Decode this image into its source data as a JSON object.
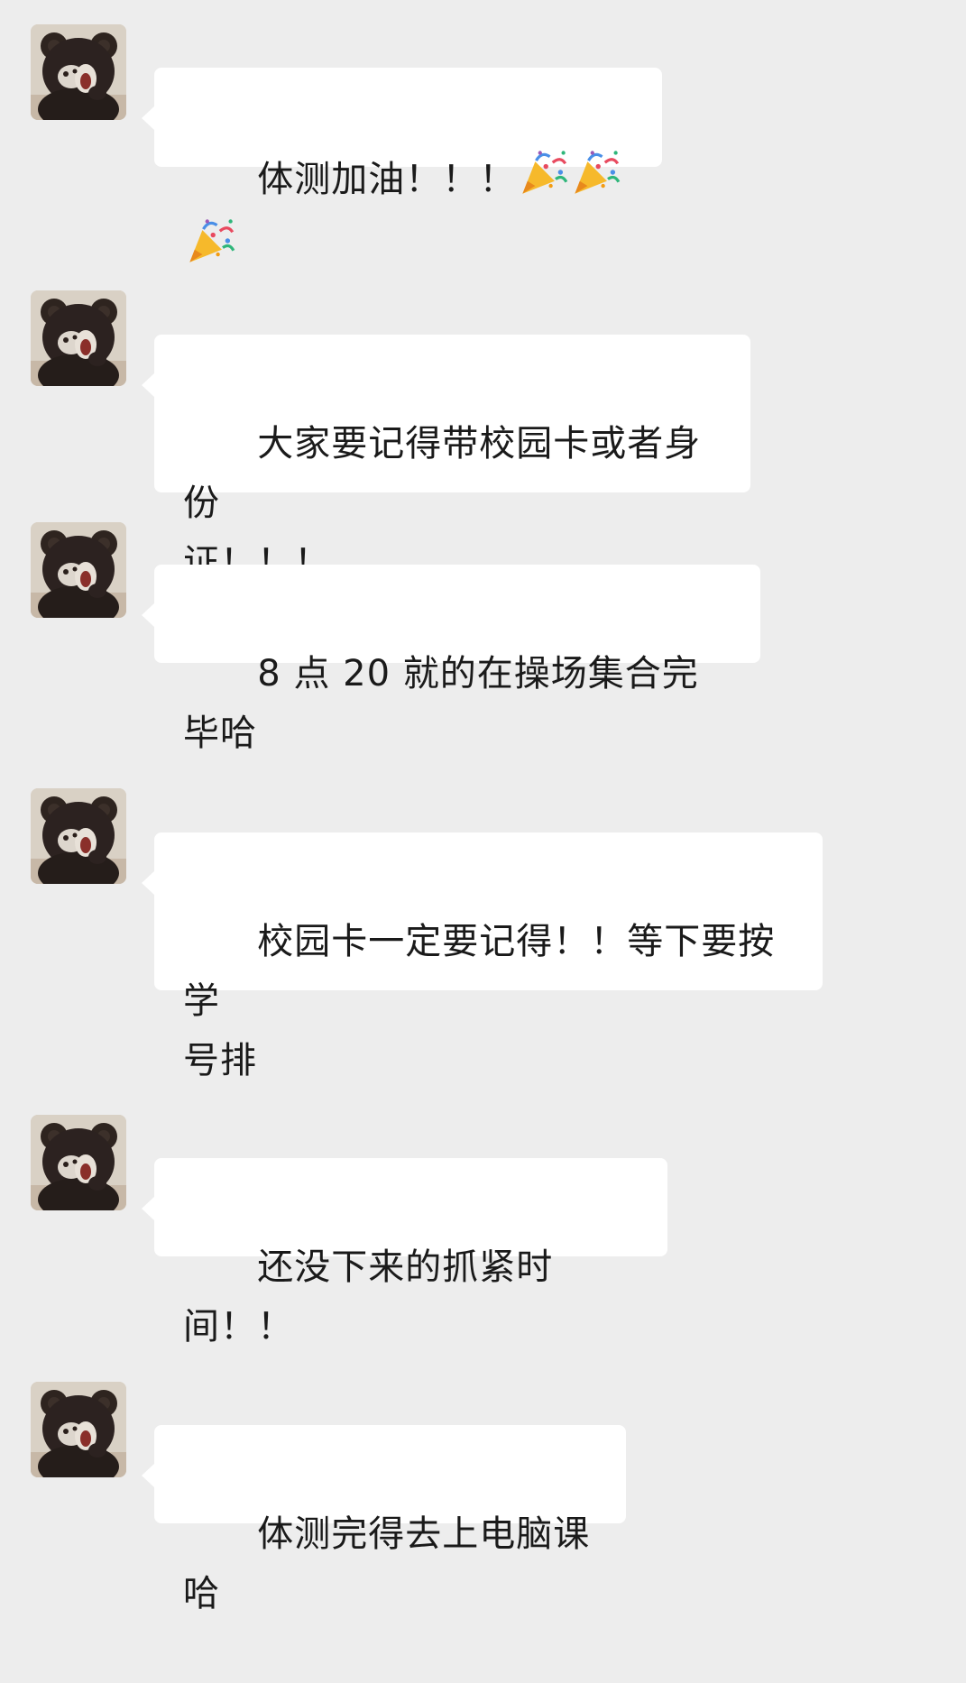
{
  "chat": {
    "messages": [
      {
        "text": "体测加油！！！",
        "emoji": [
          "party-popper-icon",
          "party-popper-icon",
          "party-popper-icon"
        ]
      },
      {
        "text": "大家要记得带校园卡或者身份\n证！！！"
      },
      {
        "text": "8 点 20 就的在操场集合完毕哈"
      },
      {
        "text": "校园卡一定要记得！！等下要按学\n号排"
      },
      {
        "text": "还没下来的抓紧时间！！"
      },
      {
        "text": "体测完得去上电脑课哈"
      }
    ]
  },
  "colors": {
    "background": "#ededed",
    "bubble": "#ffffff",
    "text": "#1a1a1a"
  }
}
